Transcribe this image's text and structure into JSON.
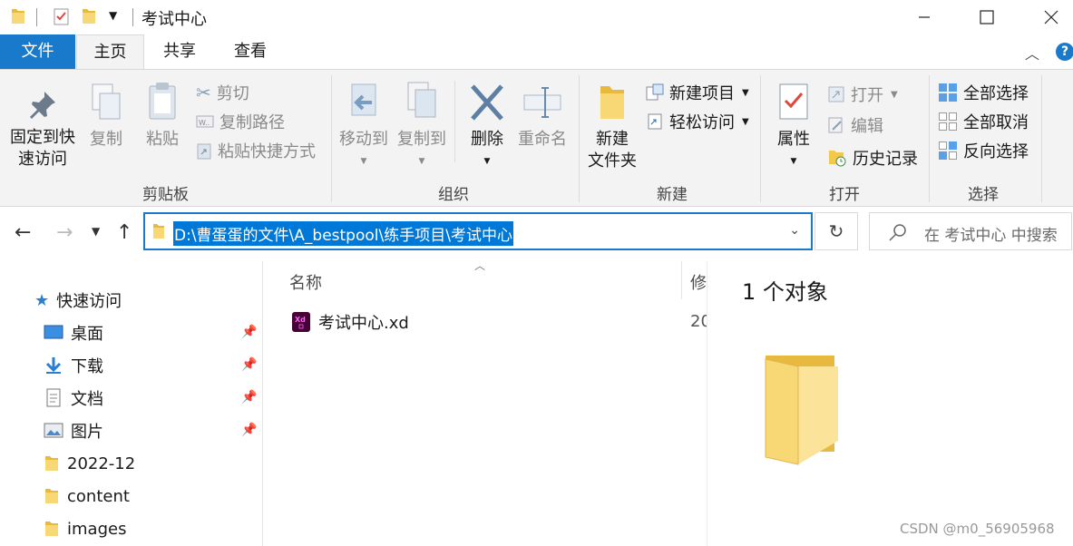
{
  "window": {
    "title": "考试中心",
    "minimize": "minimize",
    "maximize": "maximize",
    "close": "close"
  },
  "tabs": {
    "file": "文件",
    "home": "主页",
    "share": "共享",
    "view": "查看",
    "help": "?"
  },
  "ribbon": {
    "clipboard": {
      "label": "剪贴板",
      "pin_quick_access": [
        "固定到快",
        "速访问"
      ],
      "copy": "复制",
      "paste": "粘贴",
      "cut": "剪切",
      "copy_path": "复制路径",
      "paste_shortcut": "粘贴快捷方式"
    },
    "organize": {
      "label": "组织",
      "move_to": "移动到",
      "copy_to": "复制到",
      "delete": "删除",
      "rename": "重命名"
    },
    "new": {
      "label": "新建",
      "new_folder": [
        "新建",
        "文件夹"
      ],
      "new_item": "新建项目",
      "easy_access": "轻松访问"
    },
    "open": {
      "label": "打开",
      "properties": "属性",
      "open": "打开",
      "edit": "编辑",
      "history": "历史记录"
    },
    "select": {
      "label": "选择",
      "select_all": "全部选择",
      "select_none": "全部取消",
      "invert_selection": "反向选择"
    }
  },
  "address": {
    "path": "D:\\曹蛋蛋的文件\\A_bestpool\\练手项目\\考试中心",
    "search_placeholder": "在 考试中心 中搜索"
  },
  "nav_pane": {
    "quick_access": "快速访问",
    "items": [
      {
        "label": "桌面",
        "pinned": true,
        "icon": "desktop-icon"
      },
      {
        "label": "下载",
        "pinned": true,
        "icon": "download-icon"
      },
      {
        "label": "文档",
        "pinned": true,
        "icon": "document-icon"
      },
      {
        "label": "图片",
        "pinned": true,
        "icon": "picture-icon"
      },
      {
        "label": "2022-12",
        "pinned": false,
        "icon": "folder-icon"
      },
      {
        "label": "content",
        "pinned": false,
        "icon": "folder-icon"
      },
      {
        "label": "images",
        "pinned": false,
        "icon": "folder-icon"
      }
    ]
  },
  "file_list": {
    "col_name": "名称",
    "col_modified": "修",
    "files": [
      {
        "name": "考试中心.xd",
        "modified": "20",
        "icon": "adobe-xd-icon"
      }
    ]
  },
  "preview": {
    "count": "1 个对象"
  },
  "watermark": "CSDN @m0_56905968",
  "colors": {
    "accent": "#1979ca",
    "selection": "#0078d7",
    "ribbon_bg": "#f3f3f3",
    "folder": "#f8d775"
  }
}
